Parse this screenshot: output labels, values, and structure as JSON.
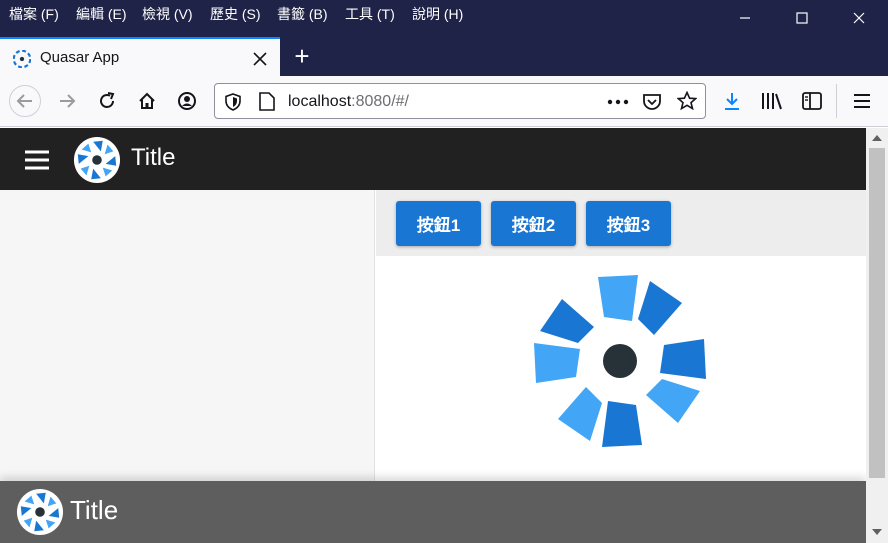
{
  "menubar": {
    "items": [
      "檔案 (F)",
      "編輯 (E)",
      "檢視 (V)",
      "歷史 (S)",
      "書籤 (B)",
      "工具 (T)",
      "說明 (H)"
    ]
  },
  "tab": {
    "title": "Quasar App"
  },
  "url": {
    "host": "localhost",
    "rest": ":8080/#/"
  },
  "app": {
    "header_title": "Title",
    "buttons": [
      "按鈕1",
      "按鈕2",
      "按鈕3"
    ],
    "footer_title": "Title"
  },
  "colors": {
    "quasar_blue": "#1976d2",
    "quasar_light": "#42a5f5",
    "header_bg": "#212121",
    "footer_bg": "#5e5e5e"
  }
}
